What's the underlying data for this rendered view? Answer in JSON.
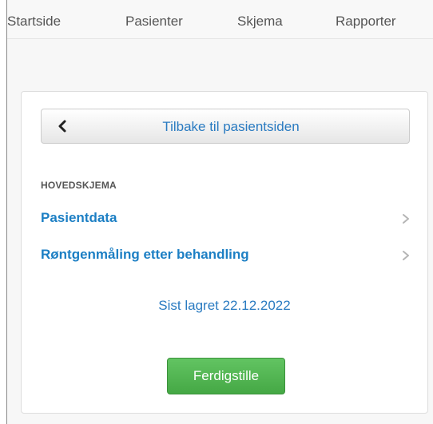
{
  "nav": {
    "items": [
      "Startside",
      "Pasienter",
      "Skjema",
      "Rapporter"
    ]
  },
  "panel": {
    "back_label": "Tilbake til pasientsiden",
    "section_title": "HOVEDSKJEMA",
    "items": [
      {
        "label": "Pasientdata"
      },
      {
        "label": "Røntgenmåling etter behandling"
      }
    ],
    "saved_text": "Sist lagret 22.12.2022",
    "finish_label": "Ferdigstille"
  },
  "colors": {
    "link": "#1c7fc4",
    "button_green": "#4cae4c",
    "nav_text": "#555555"
  },
  "icons": {
    "back": "chevron-left-icon",
    "item_arrow": "chevron-right-icon"
  }
}
